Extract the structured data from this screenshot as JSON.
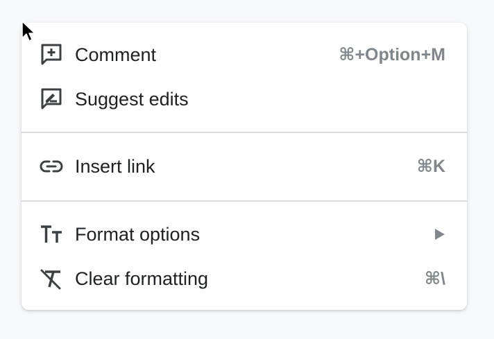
{
  "menu": {
    "items": [
      {
        "icon": "add-comment-icon",
        "label": "Comment",
        "shortcut": "⌘+Option+M"
      },
      {
        "icon": "suggest-edits-icon",
        "label": "Suggest edits",
        "shortcut": ""
      },
      {
        "icon": "link-icon",
        "label": "Insert link",
        "shortcut": "⌘K"
      },
      {
        "icon": "text-format-icon",
        "label": "Format options",
        "shortcut": "",
        "has_submenu": true
      },
      {
        "icon": "clear-formatting-icon",
        "label": "Clear formatting",
        "shortcut": "⌘\\"
      }
    ]
  },
  "colors": {
    "text": "#202124",
    "shortcut": "#80868b",
    "icon": "#3c4043",
    "divider": "#dadce0",
    "background": "#ffffff"
  }
}
